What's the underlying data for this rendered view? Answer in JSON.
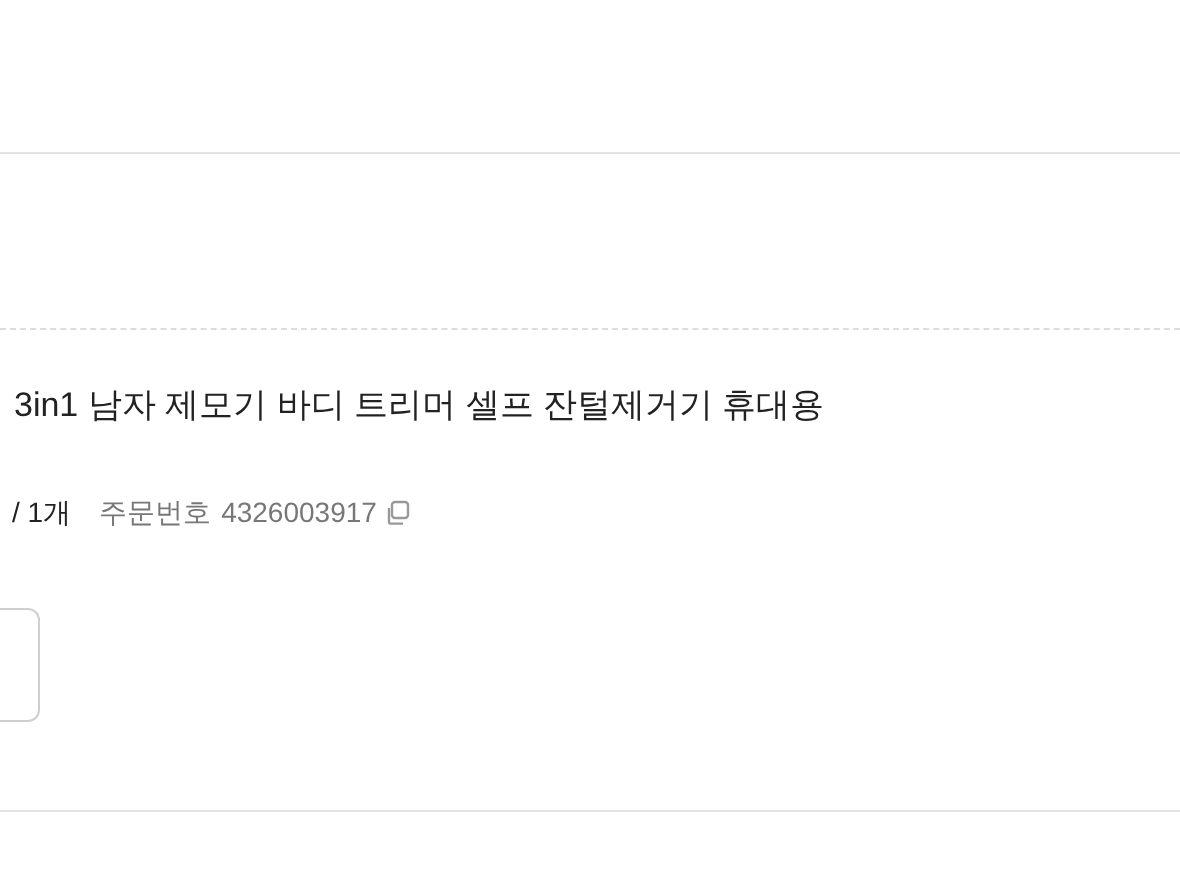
{
  "product": {
    "title": "3in1 남자 제모기 바디 트리머 셀프 잔털제거기 휴대용",
    "quantity": "/ 1개",
    "order_label": "주문번호",
    "order_number": "4326003917"
  }
}
